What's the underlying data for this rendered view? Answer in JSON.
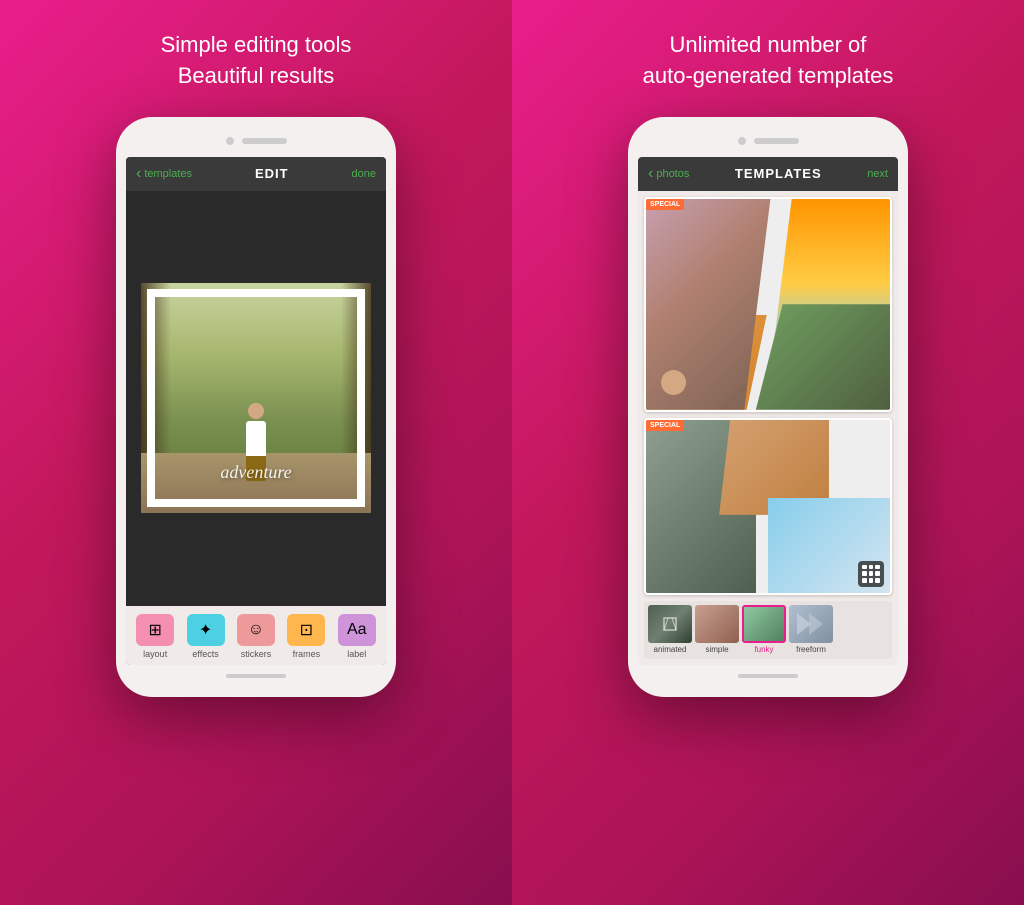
{
  "left": {
    "title_line1": "Simple editing tools",
    "title_line2": "Beautiful results",
    "screen": {
      "back_label": "templates",
      "title": "EDIT",
      "action": "done",
      "photo_text": "adventure",
      "tools": [
        {
          "id": "layout",
          "label": "layout",
          "color": "pink",
          "icon": "⊞"
        },
        {
          "id": "effects",
          "label": "effects",
          "color": "teal",
          "icon": "✦"
        },
        {
          "id": "stickers",
          "label": "stickers",
          "color": "salmon",
          "icon": "☺"
        },
        {
          "id": "frames",
          "label": "frames",
          "color": "orange",
          "icon": "⊡"
        },
        {
          "id": "label",
          "label": "label",
          "color": "lavender",
          "icon": "Aa"
        }
      ]
    }
  },
  "right": {
    "title_line1": "Unlimited number of",
    "title_line2": "auto-generated templates",
    "screen": {
      "back_label": "photos",
      "title": "TEMPLATES",
      "action": "next",
      "template1_badge": "SPECIAL",
      "template2_badge": "SPECIAL",
      "thumbnails": [
        {
          "id": "animated",
          "label": "animated",
          "active": false
        },
        {
          "id": "simple",
          "label": "simple",
          "active": false
        },
        {
          "id": "funky",
          "label": "funky",
          "active": true
        },
        {
          "id": "freeform",
          "label": "freeform",
          "active": false
        }
      ]
    }
  }
}
